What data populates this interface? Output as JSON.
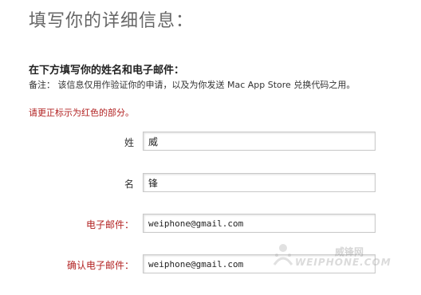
{
  "header": {
    "title": "填写你的详细信息："
  },
  "section": {
    "heading": "在下方填写你的姓名和电子邮件：",
    "note": "备注：  该信息仅用作验证你的申请，以及为你发送 Mac App Store 兑换代码之用。",
    "error_message": "请更正标示为红色的部分。"
  },
  "form": {
    "fields": [
      {
        "label": "姓",
        "value": "威",
        "state": "normal"
      },
      {
        "label": "名",
        "value": "锋",
        "state": "normal"
      },
      {
        "label": "电子邮件：",
        "value": "weiphone@gmail.com",
        "state": "error"
      },
      {
        "label": "确认电子邮件：",
        "value": "weiphone@gmail.com",
        "state": "error"
      }
    ]
  },
  "watermark": {
    "text_cn": "威锋网",
    "text_en": "WEIPHONE.COM"
  },
  "colors": {
    "error": "#b22222",
    "title": "#666666",
    "text": "#333333"
  }
}
